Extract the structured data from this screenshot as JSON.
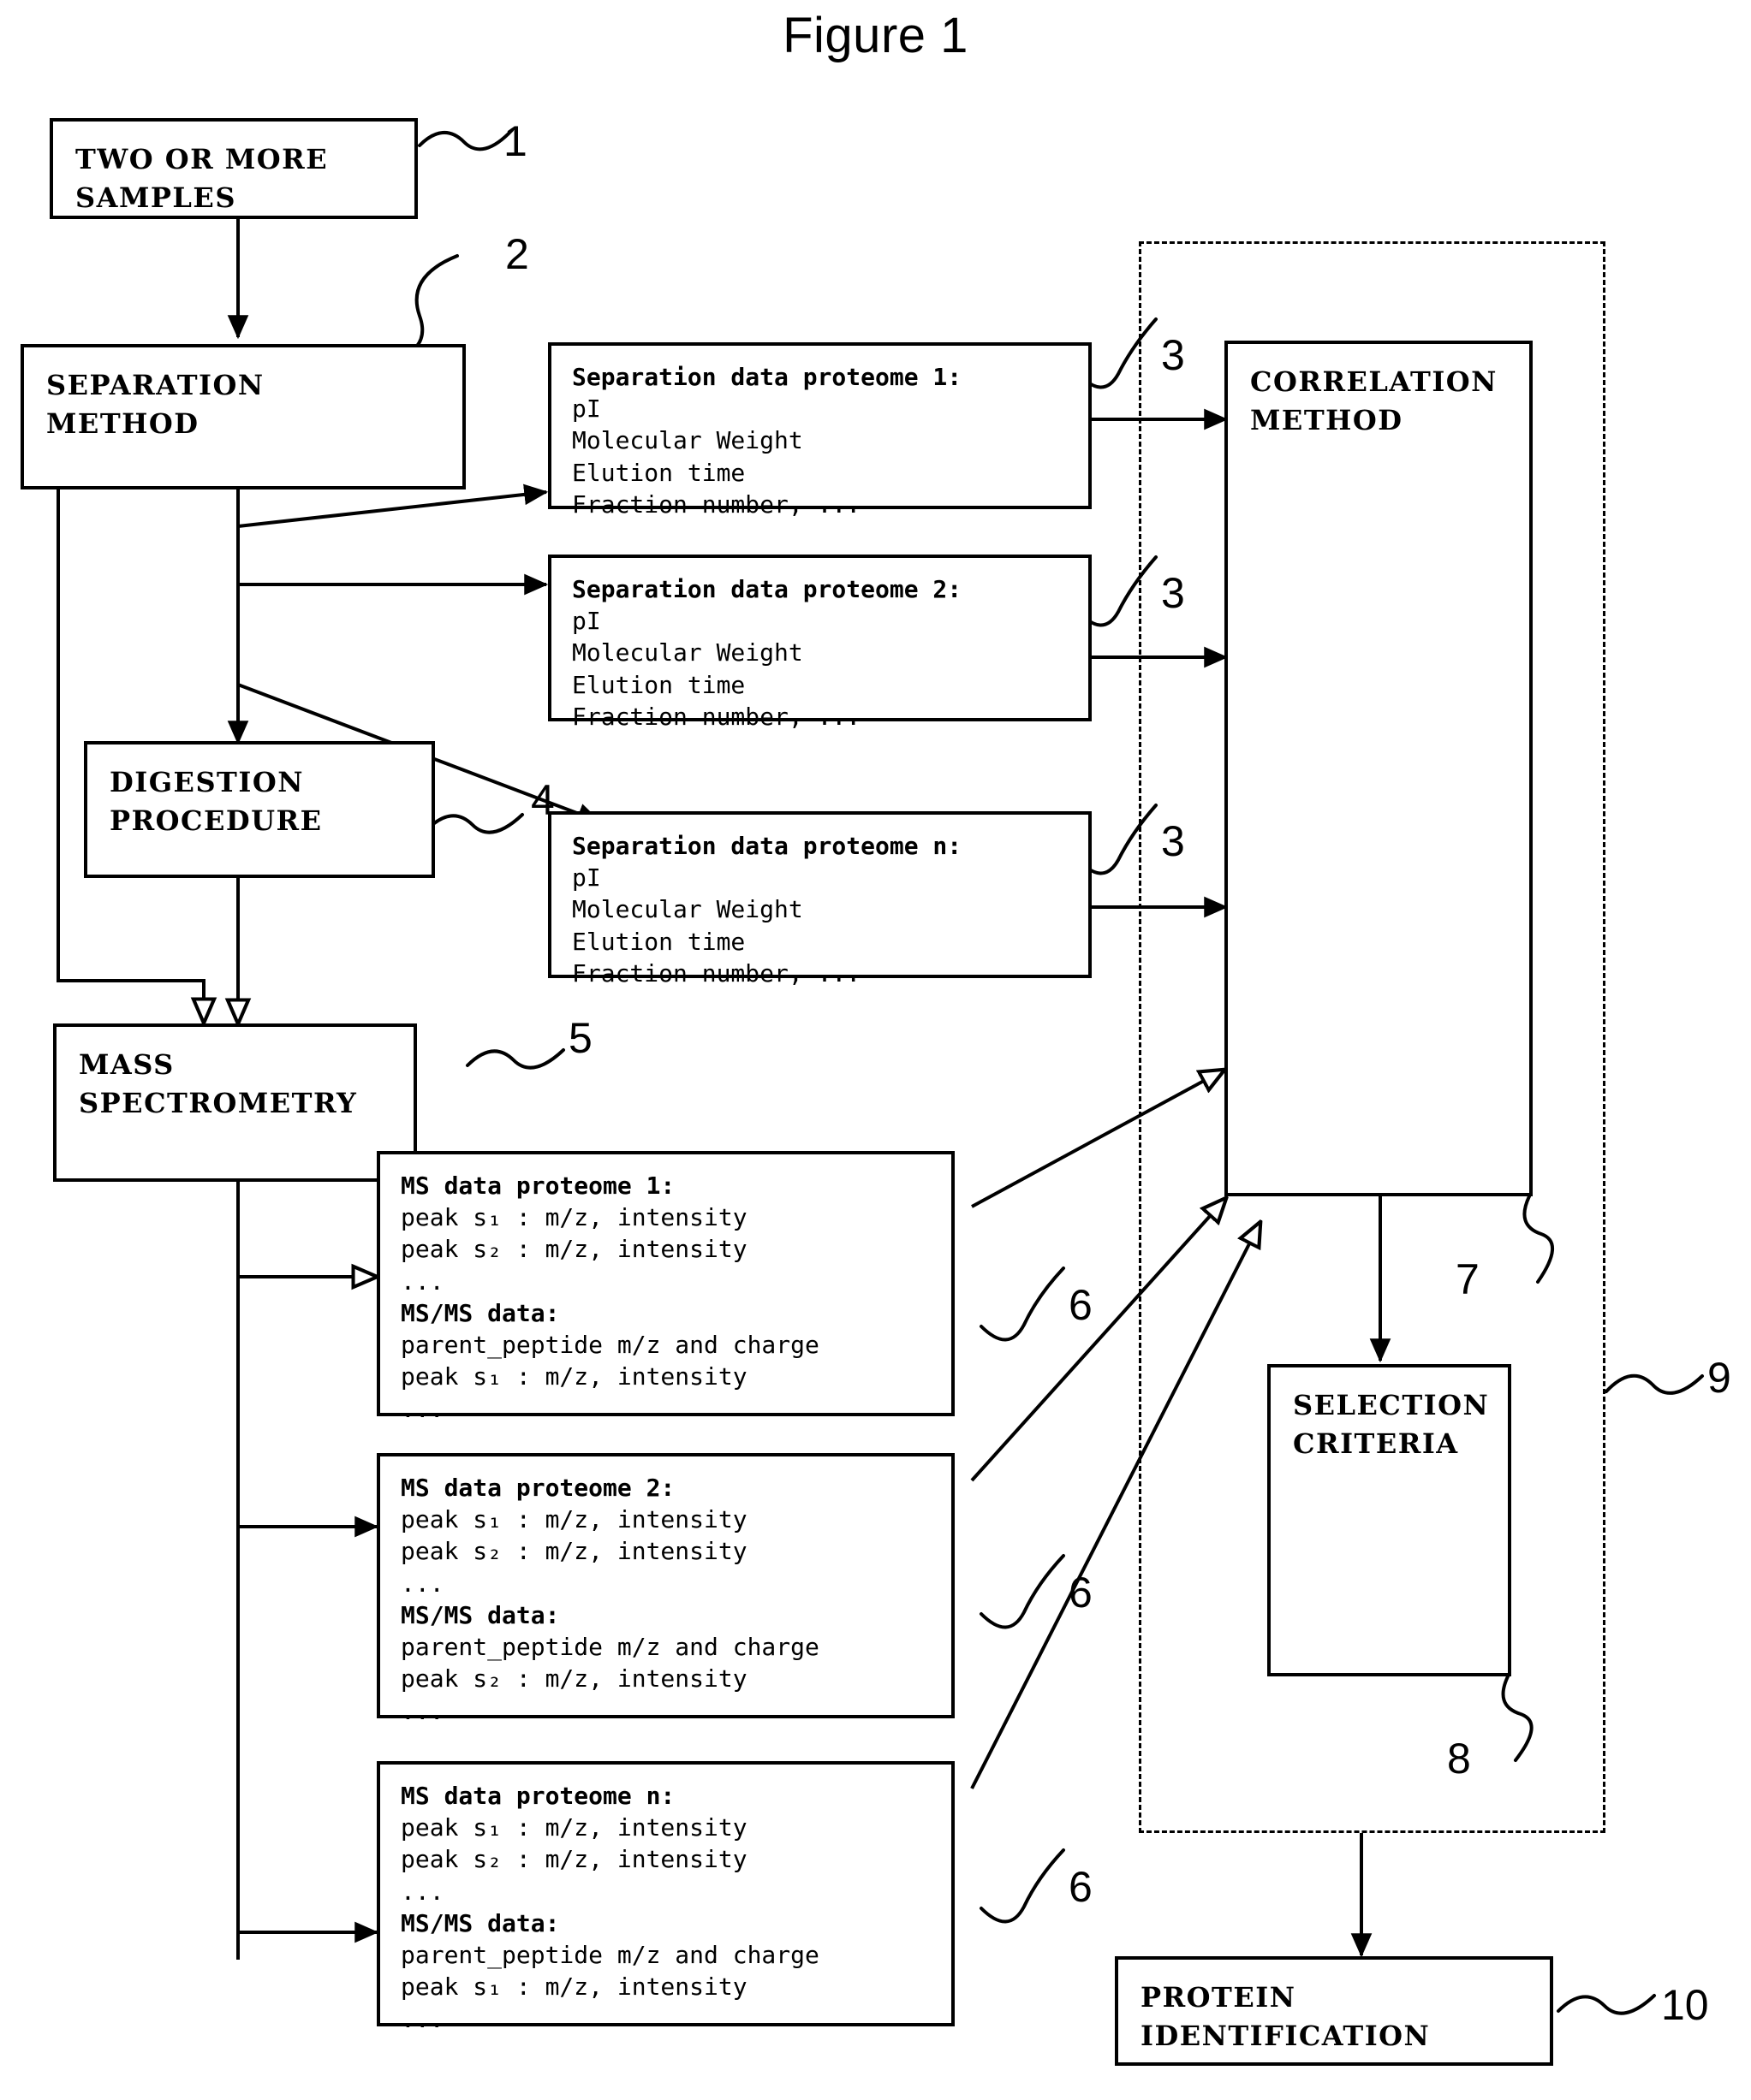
{
  "figure": {
    "title": "Figure 1"
  },
  "nodes": {
    "samples": {
      "lines": [
        "TWO OR MORE",
        "SAMPLES"
      ],
      "ref": "1"
    },
    "separation_method": {
      "lines": [
        "SEPARATION",
        "METHOD"
      ],
      "ref": "2"
    },
    "digestion_procedure": {
      "lines": [
        "DIGESTION",
        "PROCEDURE"
      ],
      "ref": "4"
    },
    "mass_spectrometry": {
      "lines": [
        "MASS",
        "SPECTROMETRY"
      ],
      "ref": "5"
    },
    "correlation_method": {
      "lines": [
        "CORRELATION",
        "METHOD"
      ],
      "ref": "7"
    },
    "selection_criteria": {
      "lines": [
        "SELECTION",
        "CRITERIA"
      ],
      "ref": "8"
    },
    "protein_identification": {
      "lines": [
        "PROTEIN",
        "IDENTIFICATION"
      ],
      "ref": "10"
    },
    "correlation_region": {
      "ref": "9"
    }
  },
  "separation_data": [
    {
      "ref": "3",
      "lines": [
        "Separation data proteome 1:",
        "pI",
        "Molecular Weight",
        "Elution time",
        "Fraction number, ..."
      ]
    },
    {
      "ref": "3",
      "lines": [
        "Separation data proteome 2:",
        "pI",
        "Molecular Weight",
        "Elution time",
        "Fraction number, ..."
      ]
    },
    {
      "ref": "3",
      "lines": [
        "Separation data proteome n:",
        "pI",
        "Molecular Weight",
        "Elution time",
        "Fraction number, ..."
      ]
    }
  ],
  "ms_data": [
    {
      "ref": "6",
      "lines": [
        "MS data proteome 1:",
        "peak s₁ : m/z, intensity",
        "peak s₂ : m/z, intensity",
        "...",
        "MS/MS data:",
        "parent_peptide m/z and charge",
        "peak s₁ : m/z, intensity",
        "..."
      ]
    },
    {
      "ref": "6",
      "lines": [
        "MS data proteome 2:",
        "peak s₁ : m/z, intensity",
        "peak s₂ : m/z, intensity",
        "...",
        "MS/MS data:",
        "parent_peptide m/z and charge",
        "peak s₂ : m/z, intensity",
        "..."
      ]
    },
    {
      "ref": "6",
      "lines": [
        "MS data proteome n:",
        "peak s₁ : m/z, intensity",
        "peak s₂ : m/z, intensity",
        "...",
        "MS/MS data:",
        "parent_peptide m/z and charge",
        "peak s₁ : m/z, intensity",
        "..."
      ]
    }
  ],
  "colors": {
    "ink": "#000000",
    "paper": "#ffffff"
  }
}
